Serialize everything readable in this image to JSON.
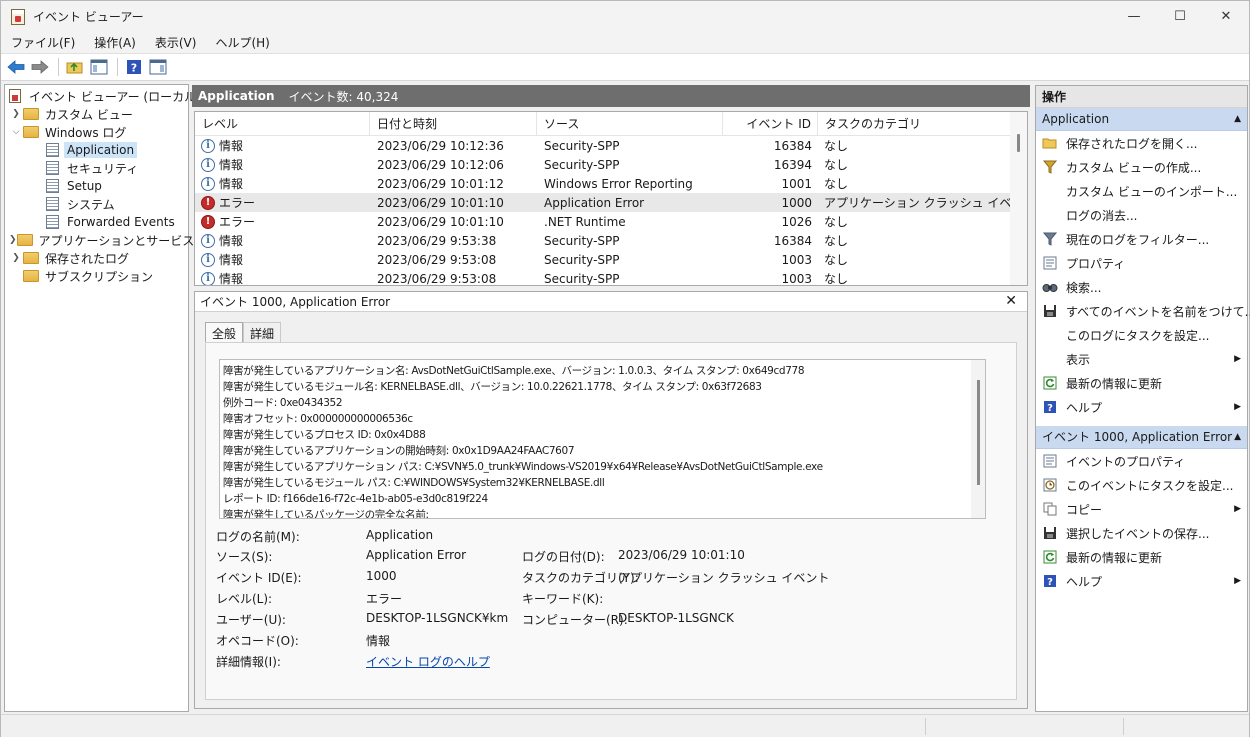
{
  "window": {
    "title": "イベント ビューアー",
    "controls": {
      "minimize": "—",
      "maximize": "☐",
      "close": "✕"
    }
  },
  "menu": [
    "ファイル(F)",
    "操作(A)",
    "表示(V)",
    "ヘルプ(H)"
  ],
  "toolbar": {
    "icons": [
      "back-icon",
      "forward-icon",
      "folder-up-icon",
      "show-hide-tree-icon",
      "help-icon",
      "show-hide-action-icon"
    ]
  },
  "tree": {
    "root": "イベント ビューアー (ローカル)",
    "custom_views": "カスタム ビュー",
    "windows_logs": "Windows ログ",
    "logs": [
      "Application",
      "セキュリティ",
      "Setup",
      "システム",
      "Forwarded Events"
    ],
    "app_service_logs": "アプリケーションとサービス ログ",
    "saved_logs": "保存されたログ",
    "subscriptions": "サブスクリプション"
  },
  "center": {
    "title": "Application",
    "count": "イベント数: 40,324"
  },
  "event_table": {
    "columns": [
      "レベル",
      "日付と時刻",
      "ソース",
      "イベント ID",
      "タスクのカテゴリ"
    ],
    "rows": [
      {
        "level": "情報",
        "type": "info",
        "date": "2023/06/29 10:12:36",
        "source": "Security-SPP",
        "id": "16384",
        "task": "なし"
      },
      {
        "level": "情報",
        "type": "info",
        "date": "2023/06/29 10:12:06",
        "source": "Security-SPP",
        "id": "16394",
        "task": "なし"
      },
      {
        "level": "情報",
        "type": "info",
        "date": "2023/06/29 10:01:12",
        "source": "Windows Error Reporting",
        "id": "1001",
        "task": "なし"
      },
      {
        "level": "エラー",
        "type": "error",
        "date": "2023/06/29 10:01:10",
        "source": "Application Error",
        "id": "1000",
        "task": "アプリケーション クラッシュ イベント"
      },
      {
        "level": "エラー",
        "type": "error",
        "date": "2023/06/29 10:01:10",
        "source": ".NET Runtime",
        "id": "1026",
        "task": "なし"
      },
      {
        "level": "情報",
        "type": "info",
        "date": "2023/06/29 9:53:38",
        "source": "Security-SPP",
        "id": "16384",
        "task": "なし"
      },
      {
        "level": "情報",
        "type": "info",
        "date": "2023/06/29 9:53:08",
        "source": "Security-SPP",
        "id": "1003",
        "task": "なし"
      },
      {
        "level": "情報",
        "type": "info",
        "date": "2023/06/29 9:53:08",
        "source": "Security-SPP",
        "id": "1003",
        "task": "なし"
      }
    ]
  },
  "detail": {
    "title": "イベント 1000, Application Error",
    "close": "✕",
    "tabs": [
      "全般",
      "詳細"
    ],
    "description": [
      "障害が発生しているアプリケーション名: AvsDotNetGuiCtlSample.exe、バージョン: 1.0.0.3、タイム スタンプ: 0x649cd778",
      "障害が発生しているモジュール名: KERNELBASE.dll、バージョン: 10.0.22621.1778、タイム スタンプ: 0x63f72683",
      "例外コード: 0xe0434352",
      "障害オフセット: 0x000000000006536c",
      "障害が発生しているプロセス ID: 0x0x4D88",
      "障害が発生しているアプリケーションの開始時刻: 0x0x1D9AA24FAAC7607",
      "障害が発生しているアプリケーション パス: C:¥SVN¥5.0_trunk¥Windows-VS2019¥x64¥Release¥AvsDotNetGuiCtlSample.exe",
      "障害が発生しているモジュール パス: C:¥WINDOWS¥System32¥KERNELBASE.dll",
      "レポート ID: f166de16-f72c-4e1b-ab05-e3d0c819f224",
      "障害が発生しているパッケージの完全な名前:"
    ],
    "props": {
      "log_name_label": "ログの名前(M):",
      "log_name": "Application",
      "source_label": "ソース(S):",
      "source": "Application Error",
      "logged_label": "ログの日付(D):",
      "logged": "2023/06/29 10:01:10",
      "event_id_label": "イベント ID(E):",
      "event_id": "1000",
      "task_label": "タスクのカテゴリ(Y):",
      "task": "アプリケーション クラッシュ イベント",
      "level_label": "レベル(L):",
      "level": "エラー",
      "keywords_label": "キーワード(K):",
      "user_label": "ユーザー(U):",
      "user": "DESKTOP-1LSGNCK¥km",
      "computer_label": "コンピューター(R):",
      "computer": "DESKTOP-1LSGNCK",
      "opcode_label": "オペコード(O):",
      "opcode": "情報",
      "more_info_label": "詳細情報(I):",
      "more_info_link": "イベント ログのヘルプ"
    }
  },
  "actions": {
    "header": "操作",
    "section1": "Application",
    "items1": [
      {
        "label": "保存されたログを開く...",
        "icon": "open-folder-icon"
      },
      {
        "label": "カスタム ビューの作成...",
        "icon": "filter-icon"
      },
      {
        "label": "カスタム ビューのインポート...",
        "icon": ""
      },
      {
        "label": "ログの消去...",
        "icon": ""
      },
      {
        "label": "現在のログをフィルター...",
        "icon": "filter-icon"
      },
      {
        "label": "プロパティ",
        "icon": "properties-icon"
      },
      {
        "label": "検索...",
        "icon": "find-icon"
      },
      {
        "label": "すべてのイベントを名前をつけて...",
        "icon": "save-icon"
      },
      {
        "label": "このログにタスクを設定...",
        "icon": ""
      },
      {
        "label": "表示",
        "icon": "",
        "submenu": true
      },
      {
        "label": "最新の情報に更新",
        "icon": "refresh-icon"
      },
      {
        "label": "ヘルプ",
        "icon": "help-icon",
        "submenu": true
      }
    ],
    "section2": "イベント 1000, Application Error",
    "items2": [
      {
        "label": "イベントのプロパティ",
        "icon": "properties-icon"
      },
      {
        "label": "このイベントにタスクを設定...",
        "icon": "task-icon"
      },
      {
        "label": "コピー",
        "icon": "copy-icon",
        "submenu": true
      },
      {
        "label": "選択したイベントの保存...",
        "icon": "save-icon"
      },
      {
        "label": "最新の情報に更新",
        "icon": "refresh-icon"
      },
      {
        "label": "ヘルプ",
        "icon": "help-icon",
        "submenu": true
      }
    ]
  },
  "colors": {
    "accent": "#c9daf0",
    "header_bar": "#6e6e6e",
    "error": "#c42b2b",
    "info": "#3d6fa8",
    "link": "#0645ad"
  }
}
